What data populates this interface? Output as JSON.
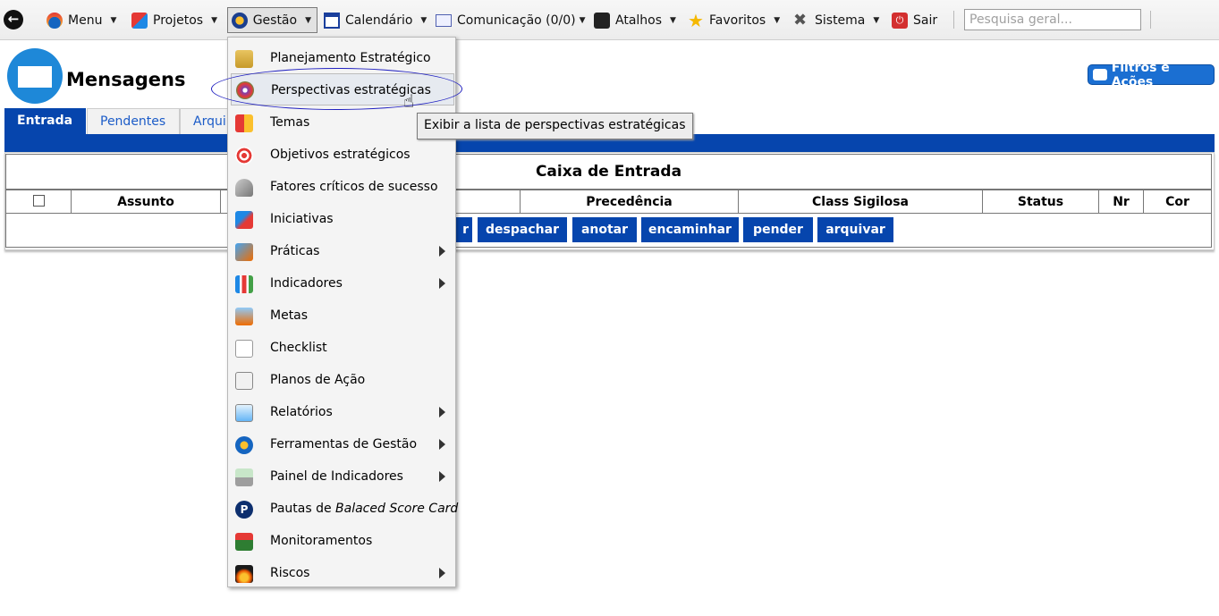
{
  "menubar": {
    "items": [
      {
        "label": "Menu",
        "icon": "drop-icon"
      },
      {
        "label": "Projetos",
        "icon": "puzzle-icon"
      },
      {
        "label": "Gestão",
        "icon": "gestao-icon"
      },
      {
        "label": "Calendário",
        "icon": "calendar-icon"
      },
      {
        "label": "Comunicação (0/0)",
        "icon": "envelope-icon"
      },
      {
        "label": "Atalhos",
        "icon": "shortcut-icon"
      },
      {
        "label": "Favoritos",
        "icon": "star-icon"
      },
      {
        "label": "Sistema",
        "icon": "tools-icon"
      },
      {
        "label": "Sair",
        "icon": "power-icon"
      }
    ],
    "search_placeholder": "Pesquisa geral..."
  },
  "header": {
    "title": "Mensagens",
    "filters_button": "Filtros e Ações"
  },
  "tabs": [
    {
      "label": "Entrada",
      "active": true
    },
    {
      "label": "Pendentes",
      "active": false
    },
    {
      "label": "Arqui",
      "active": false
    }
  ],
  "inbox": {
    "title": "Caixa de Entrada",
    "columns": [
      "Assunto",
      "Precedência",
      "Class Sigilosa",
      "Status",
      "Nr",
      "Cor"
    ],
    "actions": [
      "r",
      "despachar",
      "anotar",
      "encaminhar",
      "pender",
      "arquivar"
    ]
  },
  "dropdown": {
    "items": [
      {
        "label": "Planejamento Estratégico",
        "submenu": false
      },
      {
        "label": "Perspectivas estratégicas",
        "submenu": false,
        "hovered": true
      },
      {
        "label": "Temas",
        "submenu": false
      },
      {
        "label": "Objetivos estratégicos",
        "submenu": false
      },
      {
        "label": "Fatores críticos de sucesso",
        "submenu": false
      },
      {
        "label": "Iniciativas",
        "submenu": false
      },
      {
        "label": "Práticas",
        "submenu": true
      },
      {
        "label": "Indicadores",
        "submenu": true
      },
      {
        "label": "Metas",
        "submenu": false
      },
      {
        "label": "Checklist",
        "submenu": false
      },
      {
        "label": "Planos de Ação",
        "submenu": false
      },
      {
        "label": "Relatórios",
        "submenu": true
      },
      {
        "label": "Ferramentas de Gestão",
        "submenu": true
      },
      {
        "label": "Painel de Indicadores",
        "submenu": true
      },
      {
        "label_prefix": "Pautas de ",
        "label_italic": "Balaced Score Card",
        "submenu": false
      },
      {
        "label": "Monitoramentos",
        "submenu": false
      },
      {
        "label": "Riscos",
        "submenu": true
      }
    ],
    "tooltip": "Exibir a lista de perspectivas estratégicas"
  },
  "colors": {
    "accent": "#0645ad",
    "filters_button": "#1b6fd2",
    "logo": "#1e88d8",
    "highlight_ellipse": "#2020c0"
  }
}
